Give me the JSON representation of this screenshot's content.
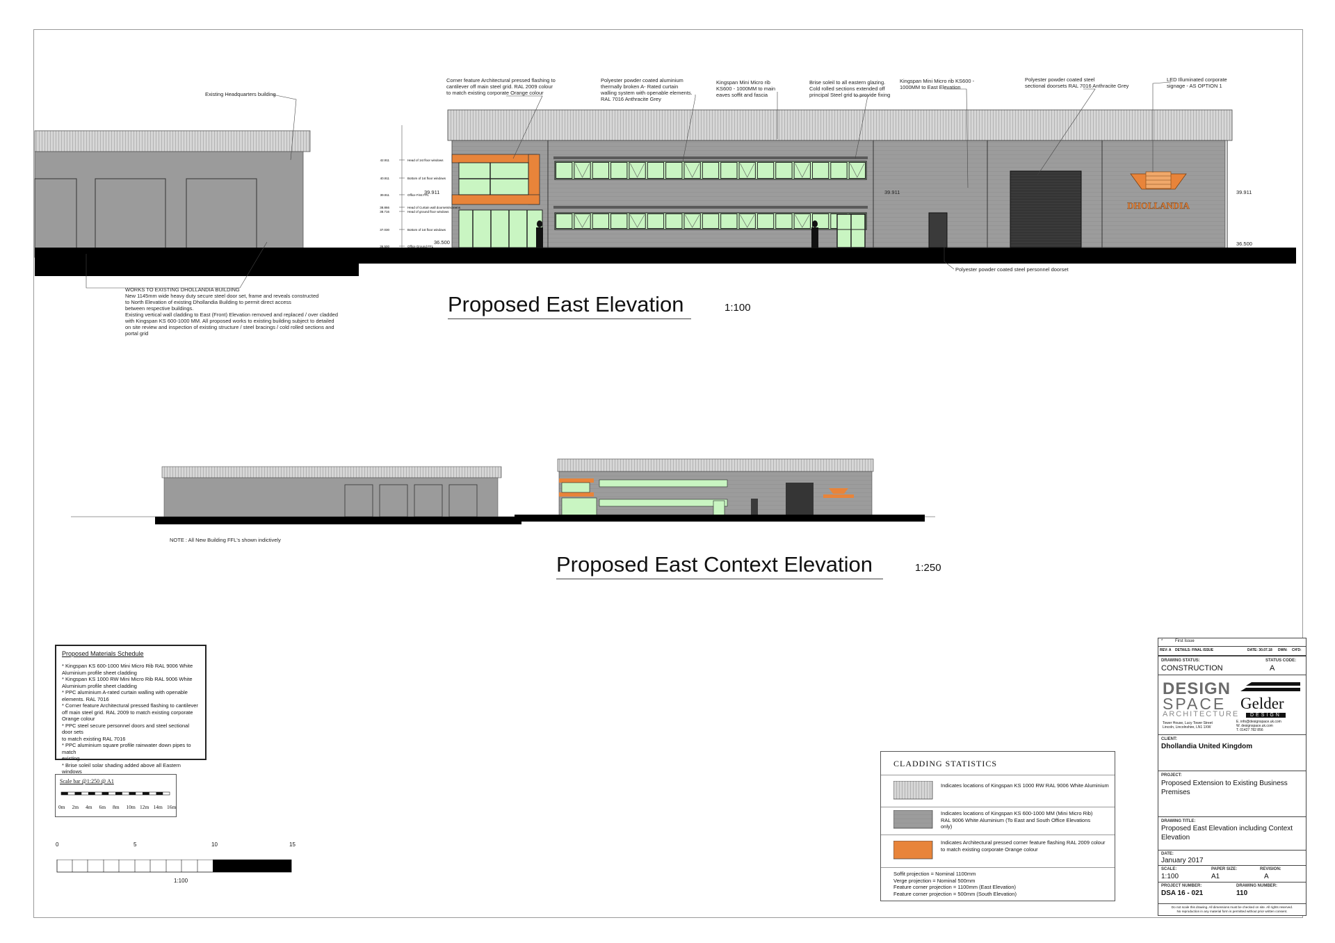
{
  "colors": {
    "wall_grey": "#9a9a9a",
    "roof_grey": "#c8c8c8",
    "glazing": "#c9f5c2",
    "orange": "#e8843a",
    "anthracite": "#3a3a3a",
    "ground": "#000000"
  },
  "elevation": {
    "title": "Proposed East Elevation",
    "scale": "1:100",
    "annotations": {
      "existing_hq": "Existing Headquarters building",
      "corner_feature": "Corner feature Architectural pressed flashing to\ncantilever off main steel grid. RAL 2009 colour\nto match existing corporate Orange colour",
      "curtain_wall": "Polyester powder coated aluminium\nthermally broken A- Rated curtain\nwalling system with openable elements.\nRAL 7016 Anthracite Grey",
      "micro_rib_soffit": "Kingspan Mini Micro rib\nKS600 - 1000MM to main\neaves soffit and fascia",
      "brise_soleil": "Brise soleil to all eastern glazing.\nCold rolled sections extended off\nprincipal Steel grid to provide fixing",
      "micro_rib_east": "Kingspan Mini Micro rib  KS600 -\n1000MM to East Elevation",
      "sectional_doors": "Polyester powder coated steel\nsectional doorsets RAL 7016 Anthracite Grey",
      "led_signage": "LED Illuminated corporate\nsignage - AS OPTION 1",
      "personnel_door": "Polyester powder coated steel personnel doorset",
      "works_existing": "WORKS TO EXISTING DHOLLANDIA BUILDING\nNew 1145mm wide heavy duty secure steel door set, frame and reveals constructed\nto North Elevation of existing Dhollandia  Building to permit direct access\nbetween respective buildings.\nExisting vertical wall cladding to East (Front) Elevation removed and replaced / over cladded\nwith Kingspan KS 600-1000 MM. All proposed works to existing building subject to detailed\non site review and inspection of existing structure / steel bracings / cold rolled sections and\nportal grid"
    },
    "level_labels": [
      "Head of 1st floor windows",
      "Bottom of 1st floor windows",
      "Office First FFL",
      "Head of Curtain wall doorsets/screens",
      "Head of ground floor windows",
      "Bottom of 1st floor windows",
      "Office Ground FFL"
    ],
    "level_values": [
      "42.911",
      "40.911",
      "39.911",
      "38.866",
      "38.716",
      "37.030",
      "36.500"
    ],
    "dims": {
      "first_ffl": "39.911",
      "ground_ffl": "36.500",
      "right_first": "39.911",
      "right_ground": "36.500",
      "mid_level": "39.911"
    },
    "signage_text": "DHOLLANDIA"
  },
  "context": {
    "title": "Proposed East Context Elevation",
    "scale": "1:250",
    "note": "NOTE : All New Building FFL's shown  indictively"
  },
  "materials": {
    "title": "Proposed Materials Schedule",
    "body": "* Kingspan KS 600-1000 Mini Micro Rib RAL 9006 White\nAluminium profile sheet cladding\n* Kingspan KS 1000 RW Mini Micro Rib RAL 9006 White\nAluminium profile sheet cladding\n* PPC aluminium A-rated curtain walling with openable\nelements. RAL 7016\n* Corner feature Architectural pressed flashing to cantilever\noff main steel grid. RAL 2009 to match existing corporate\nOrange colour\n* PPC steel secure personnel doors and steel sectional door sets\nto match existing RAL 7016\n* PPC aluminium square profile rainwater down pipes to match\nexisting\n* Brise soleil solar shading added above all Eastern windows"
  },
  "scalebar_small": {
    "title": "Scale bar @1:250 @ A1",
    "ticks": [
      "0m",
      "2m",
      "4m",
      "6m",
      "8m",
      "10m",
      "12m",
      "14m",
      "16m"
    ]
  },
  "scalebar_large": {
    "ticks": [
      "0",
      "5",
      "10",
      "15"
    ],
    "label": "1:100"
  },
  "cladding": {
    "title": "CLADDING STATISTICS",
    "rows": [
      "Indicates locations of Kingspan KS 1000 RW  RAL 9006 White Aluminium",
      "Indicates locations of Kingspan KS 600-1000 MM (Mini Micro Rib)\nRAL 9006 White Aluminium (To East and South Office Elevations\nonly)",
      "Indicates Architectural pressed corner feature flashing RAL 2009 colour\nto match existing corporate Orange colour"
    ],
    "projections": "Soffit projection = Nominal 1100mm\nVerge projection = Nominal 500mm\nFeature corner projection = 1100mm (East Elevation)\nFeature corner projection = 500mm (South Elevation)"
  },
  "title_block": {
    "rev_row": {
      "rev": "*",
      "desc": "First Issue"
    },
    "header": {
      "rev": "REV: A",
      "details": "DETAILS: FINAL ISSUE",
      "date": "DATE: 30.07.18",
      "dwn": "DWN:",
      "chkd": "CH'D:"
    },
    "drawing_status_label": "DRAWING STATUS:",
    "drawing_status": "CONSTRUCTION",
    "status_code_label": "STATUS CODE:",
    "status_code": "A",
    "logo_design": "DESIGN",
    "logo_space": "SPACE",
    "logo_arch": "ARCHITECTURE",
    "logo_gelder": "Gelder",
    "logo_gelder_sub": "DESIGN",
    "address": "Tower House, Lucy Tower Street\nLincoln, Lincolnshire, LN1 1XW",
    "contact": "E.   info@designspace.uk.com\nW.  designspace.uk.com\nT.   01427 782 856",
    "client_label": "CLIENT:",
    "client": "Dhollandia United Kingdom",
    "project_label": "PROJECT:",
    "project": "Proposed Extension to Existing Business Premises",
    "drawing_title_label": "DRAWING TITLE:",
    "drawing_title": "Proposed East Elevation including Context Elevation",
    "date_label": "DATE:",
    "date": "January 2017",
    "scale_label": "SCALE:",
    "scale": "1:100",
    "paper_label": "PAPER SIZE:",
    "paper": "A1",
    "revision_label": "REVISION:",
    "revision": "A",
    "project_number_label": "PROJECT NUMBER:",
    "project_number": "DSA 16 - 021",
    "drawing_number_label": "DRAWING NUMBER:",
    "drawing_number": "110",
    "disclaimer": "Do not scale this drawing. All dimensions must be checked on site. All rights reserved.\nNo reproduction in any material form is permitted without prior written consent."
  }
}
